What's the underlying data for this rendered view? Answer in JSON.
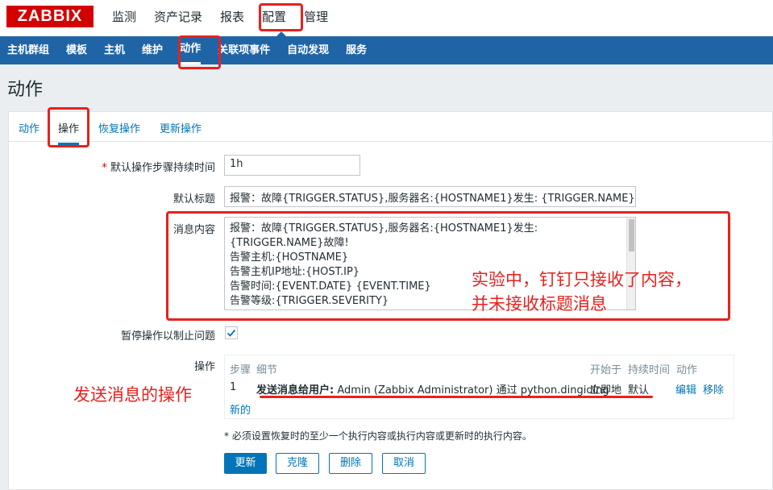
{
  "logo": "ZABBIX",
  "topmenu": [
    "监测",
    "资产记录",
    "报表",
    "配置",
    "管理"
  ],
  "subnav": [
    "主机群组",
    "模板",
    "主机",
    "维护",
    "动作",
    "关联项事件",
    "自动发现",
    "服务"
  ],
  "page_title": "动作",
  "tabs": [
    "动作",
    "操作",
    "恢复操作",
    "更新操作"
  ],
  "form": {
    "duration_label": "默认操作步骤持续时间",
    "duration_value": "1h",
    "subject_label": "默认标题",
    "subject_value": "报警：故障{TRIGGER.STATUS},服务器名:{HOSTNAME1}发生: {TRIGGER.NAME}",
    "message_label": "消息内容",
    "message_lines": [
      "报警：故障{TRIGGER.STATUS},服务器名:{HOSTNAME1}发生:",
      "{TRIGGER.NAME}故障!",
      "告警主机:{HOSTNAME}",
      "告警主机IP地址:{HOST.IP}",
      "告警时间:{EVENT.DATE} {EVENT.TIME}",
      "告警等级:{TRIGGER.SEVERITY}"
    ],
    "pause_label": "暂停操作以制止问题",
    "operations_label": "操作",
    "ops_headers": {
      "step": "步骤",
      "details": "细节",
      "start": "开始于",
      "duration": "持续时间",
      "action": "动作"
    },
    "ops_row": {
      "step": "1",
      "details_bold": "发送消息给用户:",
      "details_rest": " Admin (Zabbix Administrator) 通过 python.dingiding",
      "start": "立即地",
      "duration": "默认",
      "edit": "编辑",
      "remove": "移除"
    },
    "new_link": "新的",
    "note": "* 必须设置恢复时的至少一个执行内容或执行内容或更新时的执行内容。"
  },
  "buttons": {
    "update": "更新",
    "clone": "克隆",
    "delete": "删除",
    "cancel": "取消"
  },
  "annotations": {
    "message_note_line1": "实验中，钉钉只接收了内容，",
    "message_note_line2": "并未接收标题消息",
    "ops_note": "发送消息的操作"
  },
  "colors": {
    "brand": "#d40000",
    "nav": "#1f65a6",
    "link": "#0275b8",
    "annotation": "#e8211d"
  }
}
